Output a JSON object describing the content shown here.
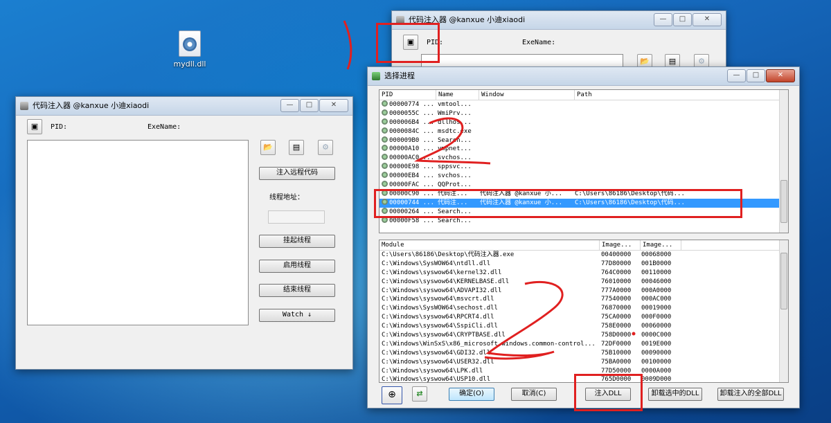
{
  "desktop": {
    "file_label": "mydll.dll"
  },
  "window_main": {
    "title": "代码注入器 @kanxue 小迪xiaodi",
    "pid_label": "PID:",
    "exe_label": "ExeName:",
    "inject_remote_label": "注入远程代码",
    "thread_addr_label": "线程地址：",
    "suspend_label": "挂起线程",
    "resume_label": "启用线程",
    "terminate_label": "结束线程",
    "watch_label": "Watch ↓"
  },
  "window_back": {
    "title": "代码注入器 @kanxue 小迪xiaodi",
    "pid_label": "PID:",
    "exe_label": "ExeName:"
  },
  "window_select": {
    "title": "选择进程",
    "process_headers": [
      "PID",
      "Name",
      "Window",
      "Path"
    ],
    "processes": [
      {
        "pid": "00000774 ...",
        "name": "vmtool...",
        "window": "",
        "path": ""
      },
      {
        "pid": "0000055C ...",
        "name": "WmiPrv...",
        "window": "",
        "path": ""
      },
      {
        "pid": "000006B4 ...",
        "name": "dllhos...",
        "window": "",
        "path": ""
      },
      {
        "pid": "0000084C ...",
        "name": "msdtc.exe",
        "window": "",
        "path": ""
      },
      {
        "pid": "000009B0 ...",
        "name": "Search...",
        "window": "",
        "path": ""
      },
      {
        "pid": "00000A10 ...",
        "name": "vmpnet...",
        "window": "",
        "path": ""
      },
      {
        "pid": "00000AC0 ...",
        "name": "svchos...",
        "window": "",
        "path": ""
      },
      {
        "pid": "00000E98 ...",
        "name": "sppsvc...",
        "window": "",
        "path": ""
      },
      {
        "pid": "00000EB4 ...",
        "name": "svchos...",
        "window": "",
        "path": ""
      },
      {
        "pid": "00000FAC ...",
        "name": "QQProt...",
        "window": "",
        "path": ""
      },
      {
        "pid": "00000C90 ...",
        "name": "代码注...",
        "window": "代码注入器 @kanxue 小...",
        "path": "C:\\Users\\86186\\Desktop\\代码..."
      },
      {
        "pid": "00000744 ...",
        "name": "代码注...",
        "window": "代码注入器 @kanxue 小...",
        "path": "C:\\Users\\86186\\Desktop\\代码..."
      },
      {
        "pid": "00000264 ...",
        "name": "Search...",
        "window": "",
        "path": ""
      },
      {
        "pid": "00000F58 ...",
        "name": "Search...",
        "window": "",
        "path": ""
      }
    ],
    "selected_index": 11,
    "module_headers": [
      "Module",
      "Image...",
      "Image..."
    ],
    "modules": [
      {
        "module": "C:\\Users\\86186\\Desktop\\代码注入器.exe",
        "base": "00400000",
        "size": "00068000"
      },
      {
        "module": "C:\\Windows\\SysWOW64\\ntdll.dll",
        "base": "77D80000",
        "size": "001B0000"
      },
      {
        "module": "C:\\Windows\\syswow64\\kernel32.dll",
        "base": "764C0000",
        "size": "00110000"
      },
      {
        "module": "C:\\Windows\\syswow64\\KERNELBASE.dll",
        "base": "76010000",
        "size": "00046000"
      },
      {
        "module": "C:\\Windows\\syswow64\\ADVAPI32.dll",
        "base": "777A0000",
        "size": "000A0000"
      },
      {
        "module": "C:\\Windows\\syswow64\\msvcrt.dll",
        "base": "77540000",
        "size": "000AC000"
      },
      {
        "module": "C:\\Windows\\SysWOW64\\sechost.dll",
        "base": "76870000",
        "size": "00019000"
      },
      {
        "module": "C:\\Windows\\syswow64\\RPCRT4.dll",
        "base": "75CA0000",
        "size": "000F0000"
      },
      {
        "module": "C:\\Windows\\syswow64\\SspiCli.dll",
        "base": "758E0000",
        "size": "00060000"
      },
      {
        "module": "C:\\Windows\\syswow64\\CRYPTBASE.dll",
        "base": "758D0000",
        "size": "0000C000"
      },
      {
        "module": "C:\\Windows\\WinSxS\\x86_microsoft.windows.common-control...",
        "base": "72DF0000",
        "size": "0019E000"
      },
      {
        "module": "C:\\Windows\\syswow64\\GDI32.dll",
        "base": "75B10000",
        "size": "00090000"
      },
      {
        "module": "C:\\Windows\\syswow64\\USER32.dll",
        "base": "75BA0000",
        "size": "00100000"
      },
      {
        "module": "C:\\Windows\\syswow64\\LPK.dll",
        "base": "77D50000",
        "size": "0000A000"
      },
      {
        "module": "C:\\Windows\\syswow64\\USP10.dll",
        "base": "765D0000",
        "size": "0009D000"
      }
    ],
    "ok_label": "确定(O)",
    "cancel_label": "取消(C)",
    "inject_dll_label": "注入DLL",
    "unload_selected_label": "卸载选中的DLL",
    "unload_all_label": "卸载注入的全部DLL"
  },
  "colors": {
    "annotation": "#e02020",
    "selection": "#3399ff"
  }
}
